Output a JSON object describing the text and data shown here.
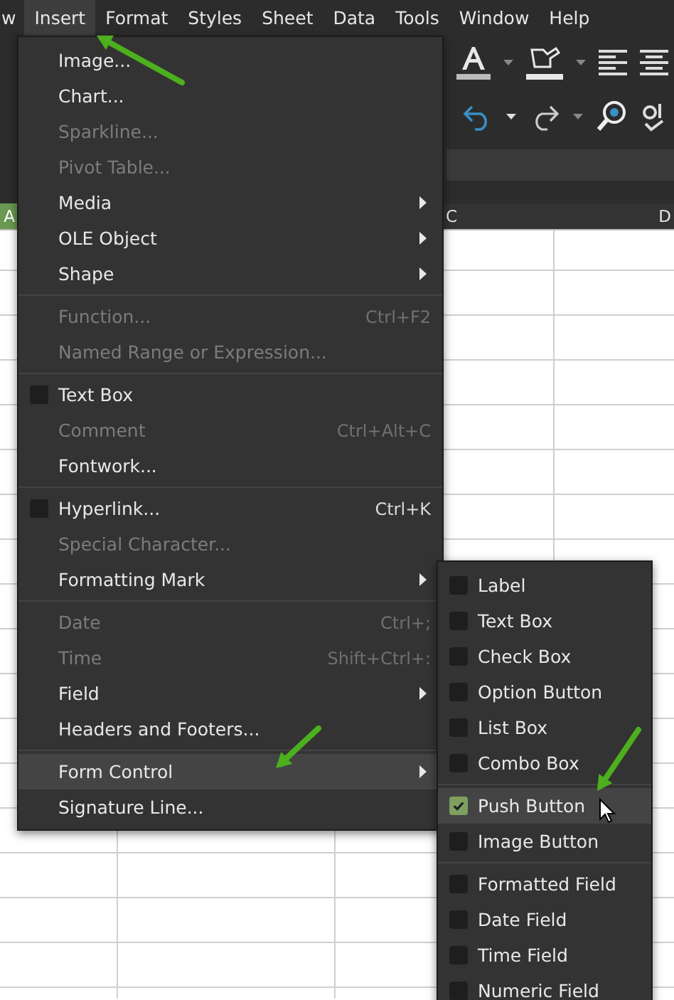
{
  "menubar": [
    {
      "label": "w",
      "selected": false
    },
    {
      "label": "Insert",
      "selected": true
    },
    {
      "label": "Format",
      "selected": false
    },
    {
      "label": "Styles",
      "selected": false
    },
    {
      "label": "Sheet",
      "selected": false
    },
    {
      "label": "Data",
      "selected": false
    },
    {
      "label": "Tools",
      "selected": false
    },
    {
      "label": "Window",
      "selected": false
    },
    {
      "label": "Help",
      "selected": false
    }
  ],
  "column_headers": [
    {
      "label": "A",
      "selected": true
    },
    {
      "label": "C",
      "selected": false
    },
    {
      "label": "D",
      "selected": false
    }
  ],
  "insert_menu": [
    {
      "kind": "item",
      "label": "Image...",
      "disabled": false,
      "selected": false
    },
    {
      "kind": "item",
      "label": "Chart...",
      "disabled": false,
      "selected": false
    },
    {
      "kind": "item",
      "label": "Sparkline...",
      "disabled": true,
      "selected": false
    },
    {
      "kind": "item",
      "label": "Pivot Table...",
      "disabled": true,
      "selected": false
    },
    {
      "kind": "submenu",
      "label": "Media",
      "disabled": false,
      "selected": false
    },
    {
      "kind": "submenu",
      "label": "OLE Object",
      "disabled": false,
      "selected": false
    },
    {
      "kind": "submenu",
      "label": "Shape",
      "disabled": false,
      "selected": false
    },
    {
      "kind": "separator"
    },
    {
      "kind": "item",
      "label": "Function...",
      "shortcut": "Ctrl+F2",
      "disabled": true,
      "selected": false
    },
    {
      "kind": "item",
      "label": "Named Range or Expression...",
      "disabled": true,
      "selected": false
    },
    {
      "kind": "separator"
    },
    {
      "kind": "checkbox",
      "label": "Text Box",
      "checked": false,
      "disabled": false,
      "selected": false
    },
    {
      "kind": "item",
      "label": "Comment",
      "shortcut": "Ctrl+Alt+C",
      "disabled": true,
      "selected": false
    },
    {
      "kind": "item",
      "label": "Fontwork...",
      "disabled": false,
      "selected": false
    },
    {
      "kind": "separator"
    },
    {
      "kind": "checkbox",
      "label": "Hyperlink...",
      "shortcut": "Ctrl+K",
      "checked": false,
      "disabled": false,
      "selected": false
    },
    {
      "kind": "item",
      "label": "Special Character...",
      "disabled": true,
      "selected": false
    },
    {
      "kind": "submenu",
      "label": "Formatting Mark",
      "disabled": false,
      "selected": false
    },
    {
      "kind": "separator"
    },
    {
      "kind": "item",
      "label": "Date",
      "shortcut": "Ctrl+;",
      "disabled": true,
      "selected": false
    },
    {
      "kind": "item",
      "label": "Time",
      "shortcut": "Shift+Ctrl+:",
      "disabled": true,
      "selected": false
    },
    {
      "kind": "submenu",
      "label": "Field",
      "disabled": false,
      "selected": false
    },
    {
      "kind": "item",
      "label": "Headers and Footers...",
      "disabled": false,
      "selected": false
    },
    {
      "kind": "separator"
    },
    {
      "kind": "submenu",
      "label": "Form Control",
      "disabled": false,
      "selected": true
    },
    {
      "kind": "item",
      "label": "Signature Line...",
      "disabled": false,
      "selected": false
    }
  ],
  "form_control_menu": [
    {
      "kind": "checkbox",
      "label": "Label",
      "checked": false,
      "selected": false
    },
    {
      "kind": "checkbox",
      "label": "Text Box",
      "checked": false,
      "selected": false
    },
    {
      "kind": "checkbox",
      "label": "Check Box",
      "checked": false,
      "selected": false
    },
    {
      "kind": "checkbox",
      "label": "Option Button",
      "checked": false,
      "selected": false
    },
    {
      "kind": "checkbox",
      "label": "List Box",
      "checked": false,
      "selected": false
    },
    {
      "kind": "checkbox",
      "label": "Combo Box",
      "checked": false,
      "selected": false
    },
    {
      "kind": "separator"
    },
    {
      "kind": "checkbox",
      "label": "Push Button",
      "checked": true,
      "selected": true
    },
    {
      "kind": "checkbox",
      "label": "Image Button",
      "checked": false,
      "selected": false
    },
    {
      "kind": "separator"
    },
    {
      "kind": "checkbox",
      "label": "Formatted Field",
      "checked": false,
      "selected": false
    },
    {
      "kind": "checkbox",
      "label": "Date Field",
      "checked": false,
      "selected": false
    },
    {
      "kind": "checkbox",
      "label": "Time Field",
      "checked": false,
      "selected": false
    },
    {
      "kind": "checkbox",
      "label": "Numeric Field",
      "checked": false,
      "selected": false
    }
  ]
}
